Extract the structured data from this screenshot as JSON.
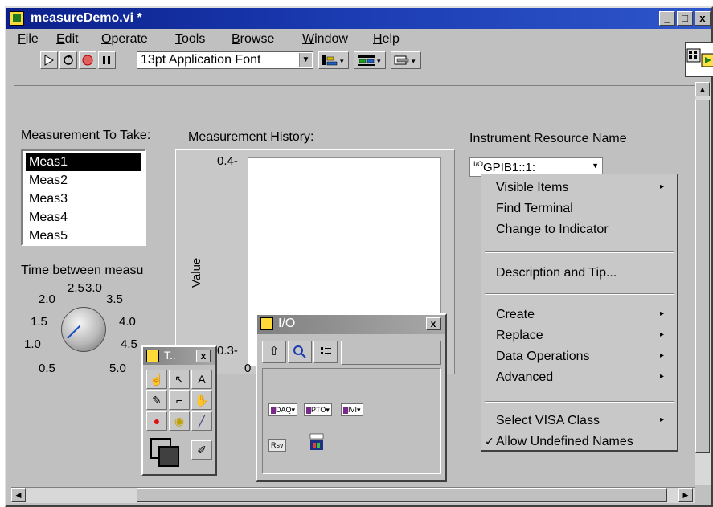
{
  "window": {
    "title": "measureDemo.vi *",
    "controls": {
      "minimize": "_",
      "maximize": "□",
      "close": "x"
    }
  },
  "menubar": {
    "items": [
      {
        "label": "File",
        "key": "F",
        "rest": "ile"
      },
      {
        "label": "Edit",
        "key": "E",
        "rest": "dit"
      },
      {
        "label": "Operate",
        "key": "O",
        "rest": "perate"
      },
      {
        "label": "Tools",
        "key": "T",
        "rest": "ools"
      },
      {
        "label": "Browse",
        "key": "B",
        "rest": "rowse"
      },
      {
        "label": "Window",
        "key": "W",
        "rest": "indow"
      },
      {
        "label": "Help",
        "key": "H",
        "rest": "elp"
      }
    ]
  },
  "toolbar": {
    "font_ring": "13pt Application Font",
    "icons": [
      "run-arrow-icon",
      "run-continuously-icon",
      "abort-stop-icon",
      "pause-icon",
      "align-objects-icon",
      "distribute-objects-icon",
      "reorder-icon"
    ]
  },
  "panel": {
    "measurement_label": "Measurement To Take:",
    "measurements": [
      "Meas1",
      "Meas2",
      "Meas3",
      "Meas4",
      "Meas5"
    ],
    "selected_measurement": "Meas1",
    "time_label": "Time between measu",
    "knob": {
      "scale": [
        "0.5",
        "1.0",
        "1.5",
        "2.0",
        "2.5",
        "3.0",
        "3.5",
        "4.0",
        "4.5",
        "5.0"
      ]
    },
    "graph": {
      "title": "Measurement History:",
      "y_axis_label": "Value",
      "y_tick_top": "0.4",
      "y_tick_bottom": "0.3",
      "x_tick_start": "0"
    },
    "instrument_label": "Instrument Resource Name",
    "instrument_value": "GPIB1::1:",
    "instrument_badge": "I/O"
  },
  "context_menu": {
    "items": [
      {
        "label": "Visible Items",
        "submenu": true
      },
      {
        "label": "Find Terminal",
        "submenu": false
      },
      {
        "label": "Change to Indicator",
        "submenu": false
      },
      {
        "label": "Description and Tip...",
        "submenu": false
      },
      {
        "label": "Create",
        "submenu": true
      },
      {
        "label": "Replace",
        "submenu": true
      },
      {
        "label": "Data Operations",
        "submenu": true
      },
      {
        "label": "Advanced",
        "submenu": true
      },
      {
        "label": "Select VISA Class",
        "submenu": true
      },
      {
        "label": "Allow Undefined Names",
        "submenu": false,
        "checked": true
      }
    ],
    "check_mark": "✓",
    "submenu_arrow": "▸"
  },
  "io_palette": {
    "title": "I/O",
    "close": "x",
    "toolbar_icons": [
      "up-arrow-icon",
      "search-icon",
      "options-icon"
    ],
    "items": [
      {
        "label": "DAQ",
        "icon": "daq-channel-icon"
      },
      {
        "label": "PTO",
        "icon": "ivi-name-icon"
      },
      {
        "label": "IVI",
        "icon": "ivi-logical-icon"
      },
      {
        "label": "Rsv",
        "icon": "visa-resource-icon"
      },
      {
        "label": "",
        "icon": "imaq-session-icon"
      }
    ]
  },
  "tools_palette": {
    "title": "T..",
    "close": "x",
    "tools": [
      "operate-hand-icon",
      "position-arrow-icon",
      "label-text-icon",
      "wiring-spool-icon",
      "object-shortcut-icon",
      "scroll-hand-icon",
      "breakpoint-icon",
      "probe-icon",
      "color-dropper-icon",
      "color-box-icon",
      "paintbrush-icon"
    ],
    "glyphs": {
      "operate": "☝",
      "position": "↖",
      "text": "A",
      "wire": "✎",
      "shortcut": "⌐",
      "scroll": "✋",
      "breakpoint": "●",
      "probe": "◉",
      "dropper": "╱",
      "brush": "✐"
    }
  },
  "colors": {
    "title_bar": "#0b1f8a",
    "panel_bg": "#c0c0c0",
    "selection": "#000000",
    "knob_needle": "#1a4cc4",
    "breakpoint_red": "#e01010"
  }
}
